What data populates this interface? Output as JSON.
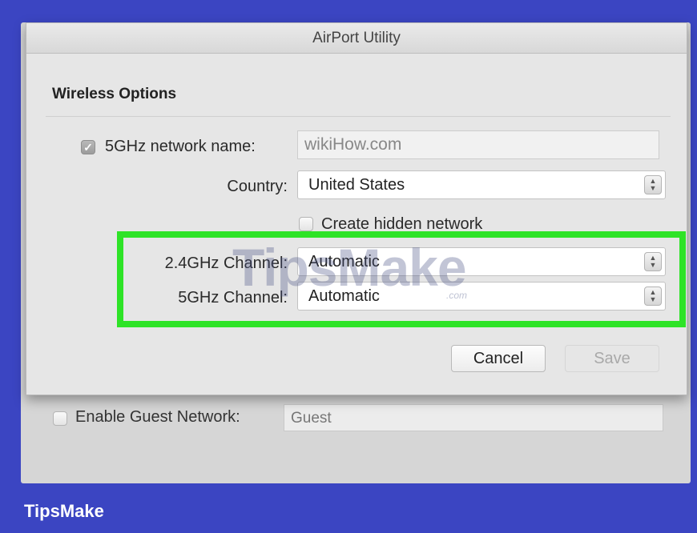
{
  "window_title": "AirPort Utility",
  "section_title": "Wireless Options",
  "network_name": {
    "checked": true,
    "label": "5GHz network name:",
    "value": "wikiHow.com"
  },
  "country": {
    "label": "Country:",
    "value": "United States"
  },
  "hidden_network": {
    "checked": false,
    "label": "Create hidden network"
  },
  "channel_24": {
    "label": "2.4GHz Channel:",
    "value": "Automatic"
  },
  "channel_5": {
    "label": "5GHz Channel:",
    "value": "Automatic"
  },
  "buttons": {
    "cancel": "Cancel",
    "save": "Save"
  },
  "guest_network": {
    "checked": false,
    "label": "Enable Guest Network:",
    "value": "Guest"
  },
  "watermark": {
    "text": "TipsMake",
    "sub": ".com"
  },
  "brand": "TipsMake",
  "colors": {
    "frame_background": "#3b45c2",
    "highlight_border": "#2ee327"
  },
  "icons": {
    "stepper": "up-down-chevron-icon",
    "checkmark": "checkmark-icon"
  }
}
